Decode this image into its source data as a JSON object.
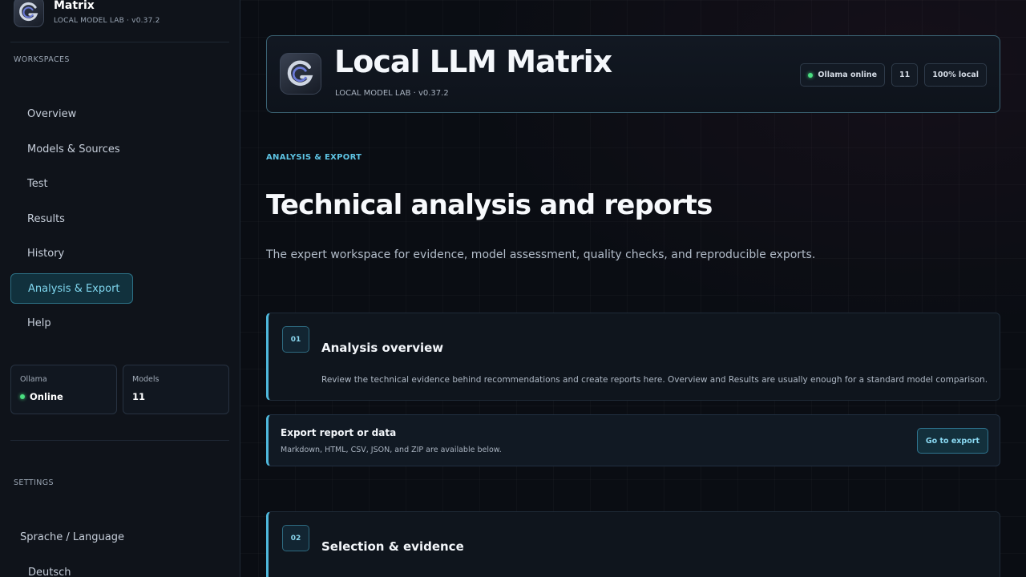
{
  "sidebar": {
    "brand_title": "Matrix",
    "brand_sub": "LOCAL MODEL LAB · v0.37.2",
    "workspaces_label": "WORKSPACES",
    "nav": [
      {
        "label": "Overview"
      },
      {
        "label": "Models & Sources"
      },
      {
        "label": "Test"
      },
      {
        "label": "Results"
      },
      {
        "label": "History"
      },
      {
        "label": "Analysis & Export",
        "active": true
      },
      {
        "label": "Help"
      }
    ],
    "stats": {
      "ollama_label": "Ollama",
      "ollama_value": "Online",
      "models_label": "Models",
      "models_value": "11"
    },
    "settings_label": "SETTINGS",
    "language_label": "Sprache / Language",
    "language_value": "Deutsch"
  },
  "header": {
    "title": "Local LLM Matrix",
    "sub": "LOCAL MODEL LAB · v0.37.2",
    "chips": {
      "ollama": "Ollama online",
      "models": "11",
      "local": "100% local"
    }
  },
  "main": {
    "eyebrow": "ANALYSIS & EXPORT",
    "title": "Technical analysis and reports",
    "description": "The expert workspace for evidence, model assessment, quality checks, and reproducible exports.",
    "panels": [
      {
        "number": "01",
        "title": "Analysis overview",
        "text": "Review the technical evidence behind recommendations and create reports here. Overview and Results are usually enough for a standard model comparison."
      },
      {
        "number": "02",
        "title": "Selection & evidence"
      }
    ],
    "export": {
      "title": "Export report or data",
      "sub": "Markdown, HTML, CSV, JSON, and ZIP are available below.",
      "button": "Go to export"
    }
  },
  "colors": {
    "accent": "#4fb8dc",
    "online": "#4ade80",
    "background": "#0a0d13"
  },
  "icons": {
    "logo": "app-logo-icon",
    "status": "status-dot-icon"
  }
}
